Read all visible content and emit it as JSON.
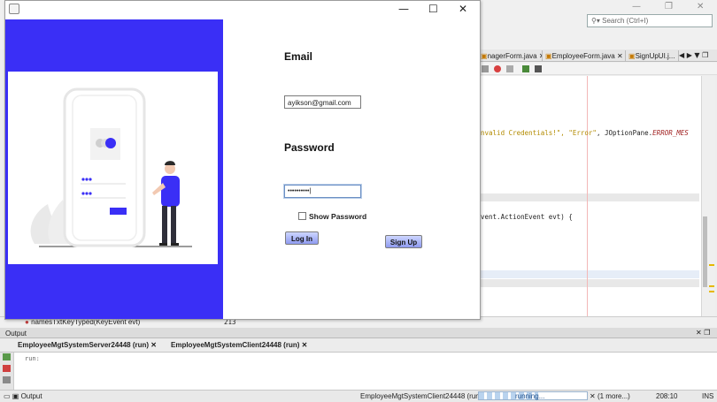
{
  "ide": {
    "search_placeholder": "Search (Ctrl+I)",
    "tabs": [
      "nagerForm.java",
      "EmployeeForm.java",
      "SignUpUI.j..."
    ],
    "code_lines": {
      "invalid_prefix": "nvalid Credentials!\", ",
      "error_str": "\"Error\"",
      "mid": ", JOptionPane.",
      "error_const": "ERROR_MES",
      "action_line": "vent.ActionEvent evt) {"
    },
    "under_strip": {
      "method_text": "namesTxtKeyTyped(KeyEvent evt)",
      "line_number": "213"
    }
  },
  "dialog": {
    "email_label": "Email",
    "email_value": "ayikson@gmail.com",
    "password_label": "Password",
    "password_value": "••••••••••",
    "show_password_label": "Show Password",
    "login_button": "Log In",
    "signup_button": "Sign Up",
    "colors": {
      "panel_blue": "#3a2ff6",
      "figure_blue": "#3a2ff6"
    }
  },
  "output": {
    "title": "Output",
    "tabs": [
      "EmployeeMgtSystemServer24448 (run)",
      "EmployeeMgtSystemClient24448 (run)"
    ],
    "run_text": "run:"
  },
  "status": {
    "output_label": "Output",
    "process": "EmployeeMgtSystemClient24448 (run)",
    "running": "running...",
    "more": "(1 more...)",
    "position": "208:10",
    "mode": "INS",
    "progress_fraction": 0.55
  }
}
